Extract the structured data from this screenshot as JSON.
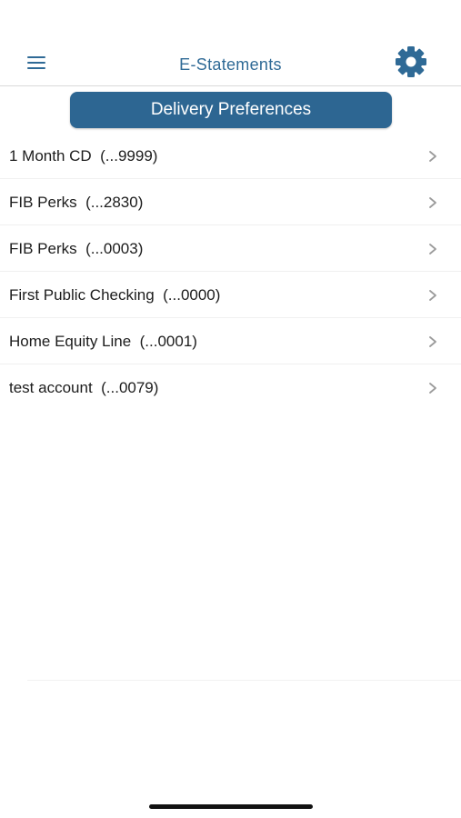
{
  "header": {
    "title": "E-Statements",
    "menu_icon": "hamburger-menu-icon",
    "settings_icon": "gear-icon"
  },
  "preferences_button": {
    "label": "Delivery Preferences"
  },
  "accounts": [
    {
      "label": "1 Month CD  (...9999)"
    },
    {
      "label": "FIB Perks  (...2830)"
    },
    {
      "label": "FIB Perks  (...0003)"
    },
    {
      "label": "First Public Checking  (...0000)"
    },
    {
      "label": "Home Equity Line  (...0001)"
    },
    {
      "label": "test account  (...0079)"
    }
  ],
  "colors": {
    "accent": "#2f6a96",
    "button_bg": "#2d6692",
    "chevron": "#9b9b9b"
  }
}
